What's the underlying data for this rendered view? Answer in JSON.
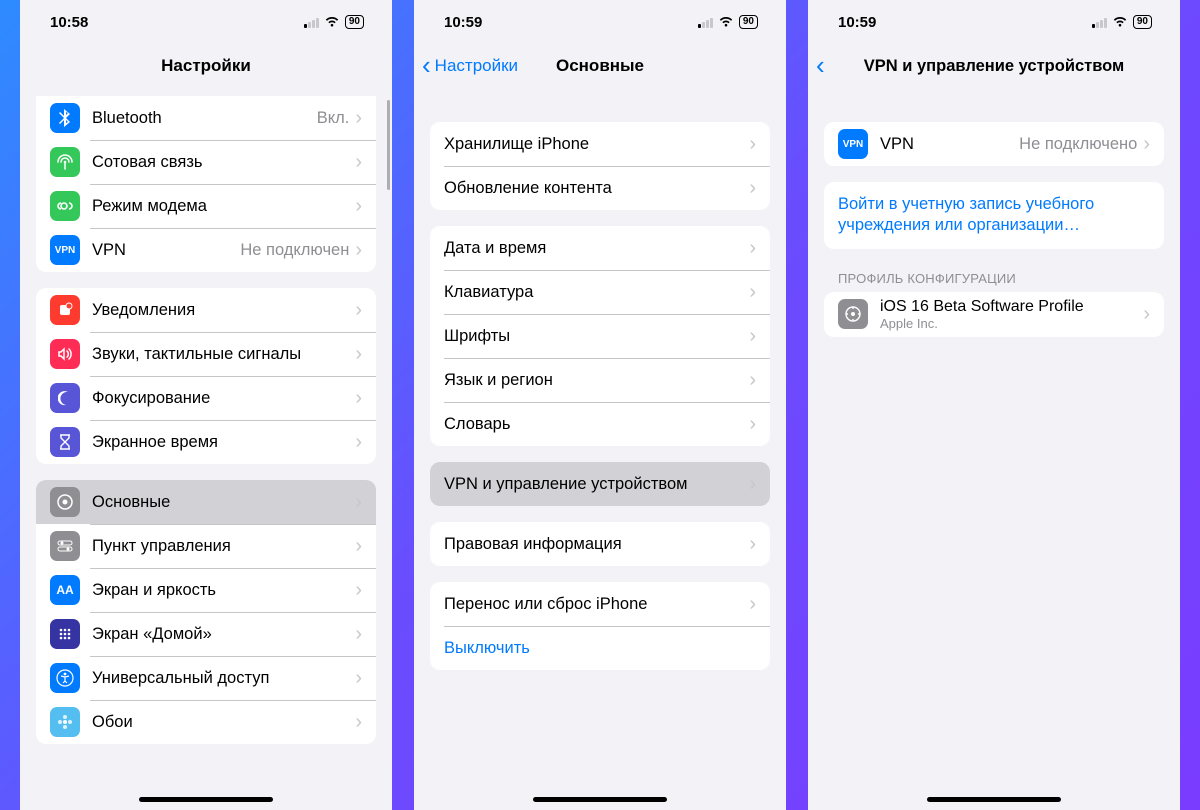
{
  "status": {
    "time1": "10:58",
    "time2": "10:59",
    "time3": "10:59",
    "battery": "90"
  },
  "phone1": {
    "title": "Настройки",
    "groups": [
      [
        {
          "icon": "bluetooth",
          "bg": "#007aff",
          "label": "Bluetooth",
          "value": "Вкл."
        },
        {
          "icon": "cellular",
          "bg": "#34c759",
          "label": "Сотовая связь"
        },
        {
          "icon": "hotspot",
          "bg": "#34c759",
          "label": "Режим модема"
        },
        {
          "icon": "vpn",
          "bg": "#007aff",
          "label": "VPN",
          "value": "Не подключен"
        }
      ],
      [
        {
          "icon": "notif",
          "bg": "#ff3b30",
          "label": "Уведомления"
        },
        {
          "icon": "sounds",
          "bg": "#ff2d55",
          "label": "Звуки, тактильные сигналы"
        },
        {
          "icon": "focus",
          "bg": "#5856d6",
          "label": "Фокусирование"
        },
        {
          "icon": "screentime",
          "bg": "#5856d6",
          "label": "Экранное время"
        }
      ],
      [
        {
          "icon": "general",
          "bg": "#8e8e93",
          "label": "Основные",
          "highlight": true
        },
        {
          "icon": "control",
          "bg": "#8e8e93",
          "label": "Пункт управления"
        },
        {
          "icon": "display",
          "bg": "#007aff",
          "label": "Экран и яркость"
        },
        {
          "icon": "home",
          "bg": "#3634a3",
          "label": "Экран «Домой»"
        },
        {
          "icon": "access",
          "bg": "#007aff",
          "label": "Универсальный доступ"
        },
        {
          "icon": "wall",
          "bg": "#55bef0",
          "label": "Обои"
        }
      ]
    ]
  },
  "phone2": {
    "back": "Настройки",
    "title": "Основные",
    "groups": [
      [
        {
          "label": "Хранилище iPhone"
        },
        {
          "label": "Обновление контента"
        }
      ],
      [
        {
          "label": "Дата и время"
        },
        {
          "label": "Клавиатура"
        },
        {
          "label": "Шрифты"
        },
        {
          "label": "Язык и регион"
        },
        {
          "label": "Словарь"
        }
      ],
      [
        {
          "label": "VPN и управление устройством",
          "highlight": true
        }
      ],
      [
        {
          "label": "Правовая информация"
        }
      ],
      [
        {
          "label": "Перенос или сброс iPhone"
        },
        {
          "label": "Выключить",
          "blue": true,
          "noChevron": true
        }
      ]
    ]
  },
  "phone3": {
    "title": "VPN и управление устройством",
    "vpn": {
      "label": "VPN",
      "value": "Не подключено"
    },
    "signin": "Войти в учетную запись учебного учреждения или организации…",
    "profileHeader": "ПРОФИЛЬ КОНФИГУРАЦИИ",
    "profile": {
      "label": "iOS 16 Beta Software Profile",
      "sub": "Apple Inc."
    }
  }
}
